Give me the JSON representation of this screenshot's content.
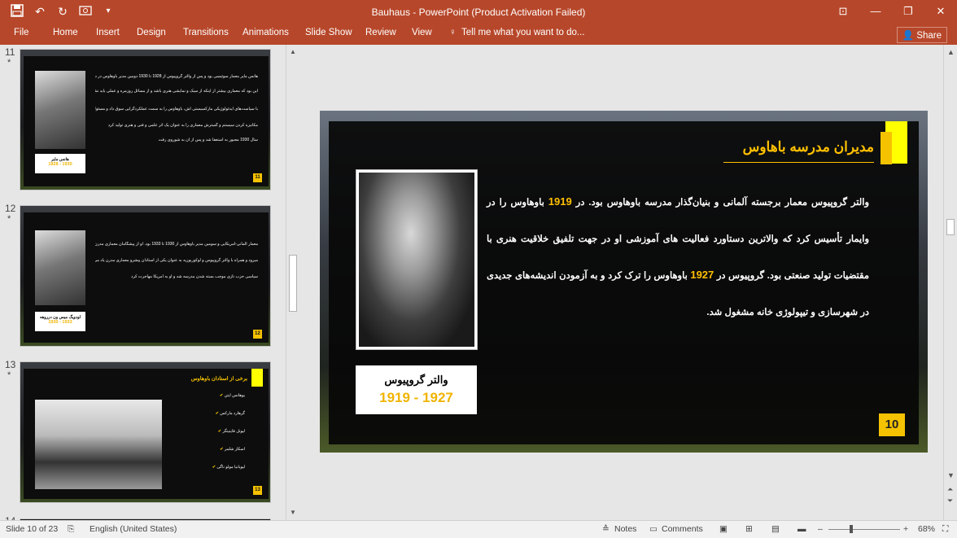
{
  "titlebar": {
    "title": "Bauhaus - PowerPoint (Product Activation Failed)",
    "qat": [
      "save-icon",
      "undo-icon",
      "redo-icon",
      "start-from-beginning-icon",
      "customize-icon"
    ],
    "window_controls": [
      "ribbon-display-icon",
      "minimize-icon",
      "maximize-icon",
      "close-icon"
    ]
  },
  "ribbon": {
    "tabs": [
      "File",
      "Home",
      "Insert",
      "Design",
      "Transitions",
      "Animations",
      "Slide Show",
      "Review",
      "View"
    ],
    "tell_me": "Tell me what you want to do...",
    "share": "Share"
  },
  "thumbnails": [
    {
      "number": "11",
      "star": "*",
      "card_name": "هانس مایر",
      "card_years": "1928 - 1930",
      "text_lines": [
        "هانس مایر معمار سوئیسی بود و پس از والتر گروپیوس از 1928 تا 1930 دومین مدیر باوهاوس در دسائو بود. او بر",
        "این بود که معماری بیشتر از اینکه از سبک و نمایشی هنری باشد و از مسائل روزمره و عملی باید نشات گیرد",
        "با سیاست‌های ایدئولوژیکی مارکسیستی اش، باوهاوس را به سمت عملکردگرایی سوق داد و مسئولیت",
        "مکانیزه کردن سیستم و گسترش معماری را به عنوان یک اثر علمی و فنی و هنری تولید کرد",
        "سال 1930 مجبور به استعفا شد و پس از آن به شوروی رفت"
      ],
      "slide_number": "11"
    },
    {
      "number": "12",
      "star": "*",
      "card_name": "لودویگ میس ون درروهه",
      "card_years": "1930 - 1933",
      "text_lines": [
        "معمار آلمانی-آمریکایی و سومین مدیر باوهاوس از 1930 تا 1933 بود. او از پیشگامان معماری مدرن به شمار",
        "میرود و همراه با والتر گروپیوس و لوکوربوزیه به عنوان یکی از استادان پیشرو معماری مدرن یاد می‌شود. بعد از 1933 فعالیت",
        "سیاسی حزب نازی موجب بسته شدن مدرسه شد و او به آمریکا مهاجرت کرد"
      ],
      "slide_number": "12"
    },
    {
      "number": "13",
      "star": "*",
      "title": "برخی از استادان باوهاوس",
      "bullets": [
        "یوهانس ایتن",
        "گرهارد مارکس",
        "لیونل فاینینگر",
        "اسکار شلمر",
        "لیوبانیا مولو ناگی"
      ],
      "slide_number": "13"
    },
    {
      "number": "14"
    }
  ],
  "slide": {
    "title": "مدیران مدرسه باهاوس",
    "paragraph_parts": [
      {
        "text": "والتر گروپیوس معمار برجسته آلمانی و بنیان‌گذار مدرسه باوهاوس بود. در ",
        "hl": false
      },
      {
        "text": "1919",
        "hl": true
      },
      {
        "text": " باوهاوس را در وایمار تأسیس کرد که والاترین دستاورد فعالیت های آموزشی او در جهت تلفیق خلاقیت هنری با مقتضیات تولید صنعتی بود. گروپیوس در ",
        "hl": false
      },
      {
        "text": "1927",
        "hl": true
      },
      {
        "text": " باوهاوس را ترک کرد و به آزمودن اندیشه‌های جدیدی در شهرسازی و تیپولوژی خانه مشغول شد.",
        "hl": false
      }
    ],
    "name": "والتر گروپیوس",
    "years": "1919 - 1927",
    "slide_number": "10"
  },
  "statusbar": {
    "slide_info": "Slide 10 of 23",
    "language": "English (United States)",
    "notes": "Notes",
    "comments": "Comments",
    "zoom": "68%",
    "zoom_value": 68
  },
  "colors": {
    "ribbon": "#b7472a",
    "accent_yellow": "#ffc000",
    "block_yellow": "#ffff00",
    "slide_panel": "#0d0d0d"
  }
}
